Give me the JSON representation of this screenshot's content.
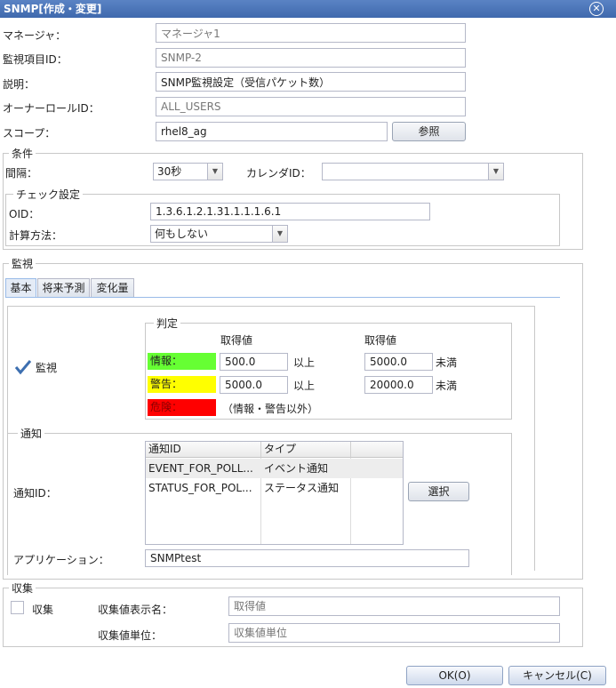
{
  "window": {
    "title": "SNMP[作成・変更]"
  },
  "general": {
    "manager_label": "マネージャ：",
    "manager_value": "マネージャ1",
    "monitor_id_label": "監視項目ID：",
    "monitor_id_value": "SNMP-2",
    "description_label": "説明：",
    "description_value": "SNMP監視設定（受信パケット数）",
    "owner_role_label": "オーナーロールID：",
    "owner_role_value": "ALL_USERS",
    "scope_label": "スコープ：",
    "scope_value": "rhel8_ag",
    "browse_button": "参照"
  },
  "condition": {
    "legend": "条件",
    "interval_label": "間隔：",
    "interval_value": "30秒",
    "calendar_label": "カレンダID：",
    "calendar_value": "",
    "check_settings": {
      "legend": "チェック設定",
      "oid_label": "OID：",
      "oid_value": "1.3.6.1.2.1.31.1.1.1.6.1",
      "calc_label": "計算方法：",
      "calc_value": "何もしない"
    }
  },
  "monitor": {
    "legend": "監視",
    "tabs": [
      "基本",
      "将来予測",
      "変化量"
    ],
    "monitor_checkbox_label": "監視",
    "judgement": {
      "legend": "判定",
      "col_header_1": "取得値",
      "col_header_2": "取得値",
      "info_label": "情報：",
      "info_color": "#66ff33",
      "info_lower": "500.0",
      "info_upper": "5000.0",
      "warn_label": "警告：",
      "warn_color": "#ffff00",
      "warn_lower": "5000.0",
      "warn_upper": "20000.0",
      "crit_label": "危険：",
      "crit_color": "#ff0000",
      "crit_note": "（情報・警告以外）",
      "ge_label": "以上",
      "lt_label": "未満"
    },
    "notify": {
      "legend": "通知",
      "notify_id_label": "通知ID：",
      "columns": [
        "通知ID",
        "タイプ"
      ],
      "rows": [
        {
          "id": "EVENT_FOR_POLL...",
          "type": "イベント通知"
        },
        {
          "id": "STATUS_FOR_POL...",
          "type": "ステータス通知"
        }
      ],
      "select_button": "選択",
      "application_label": "アプリケーション：",
      "application_value": "SNMPtest"
    }
  },
  "collect": {
    "legend": "収集",
    "checkbox_label": "収集",
    "display_name_label": "収集値表示名：",
    "display_name_placeholder": "取得値",
    "unit_label": "収集値単位：",
    "unit_placeholder": "収集値単位"
  },
  "footer": {
    "ok_button": "OK(O)",
    "cancel_button": "キャンセル(C)"
  }
}
